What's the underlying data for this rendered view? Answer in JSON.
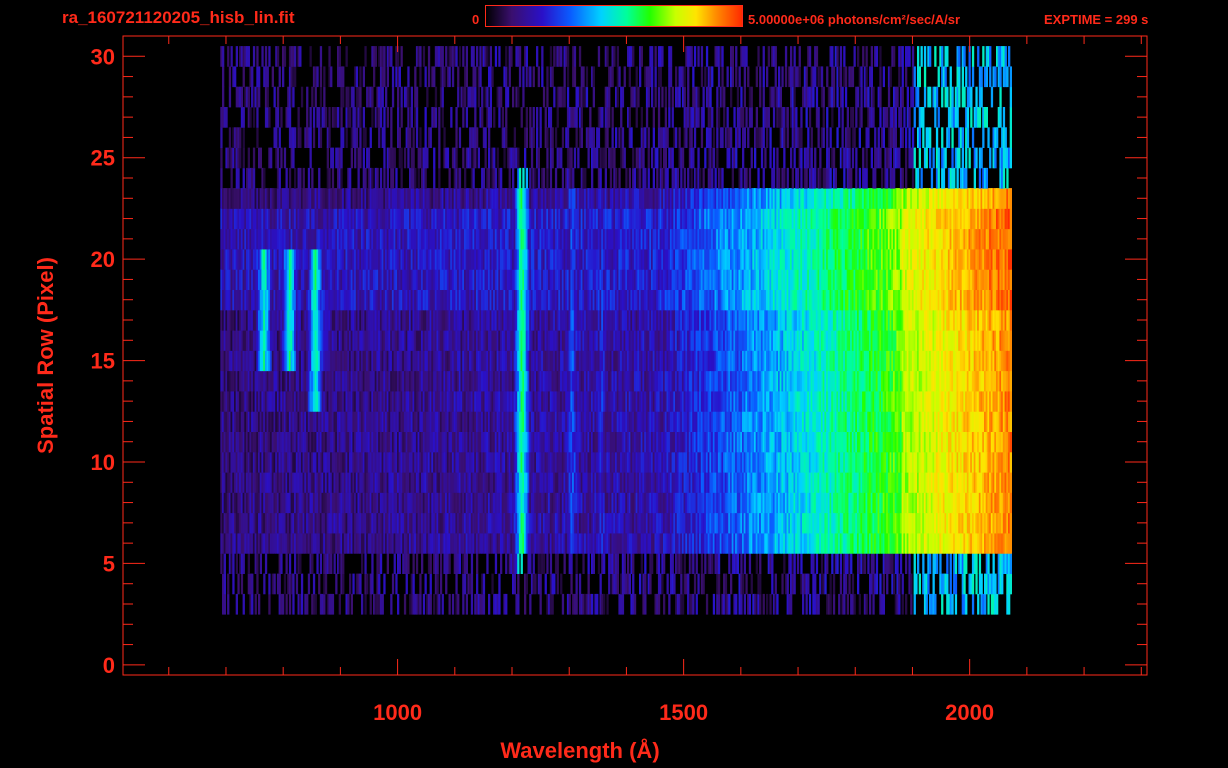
{
  "header": {
    "file_title": "ra_160721120205_hisb_lin.fit",
    "colorbar_min_label": "0",
    "colorbar_max_label": "5.00000e+06 photons/cm²/sec/A/sr",
    "exptime_label": "EXPTIME = 299 s"
  },
  "colors": {
    "axis": "#ff2a1a",
    "background": "#000000",
    "colormap": [
      "#000000",
      "#3a0f6e",
      "#2a10c8",
      "#0a5cff",
      "#00d2ff",
      "#00ff9a",
      "#22ff00",
      "#c8ff00",
      "#ffe400",
      "#ff8a00",
      "#ff2a00"
    ]
  },
  "chart_data": {
    "type": "heatmap",
    "title": "ra_160721120205_hisb_lin.fit",
    "xlabel": "Wavelength (Å)",
    "ylabel": "Spatial Row (Pixel)",
    "xlim": [
      520,
      2310
    ],
    "ylim": [
      -0.5,
      31
    ],
    "x_ticks": [
      1000,
      1500,
      2000
    ],
    "x_tick_labels": [
      "1000",
      "1500",
      "2000"
    ],
    "y_ticks": [
      0,
      5,
      10,
      15,
      20,
      25,
      30
    ],
    "y_tick_labels": [
      "0",
      "5",
      "10",
      "15",
      "20",
      "25",
      "30"
    ],
    "color_range": [
      0,
      5000000
    ],
    "color_unit": "photons/cm²/sec/A/sr",
    "data_x_range": [
      690,
      2070
    ],
    "slit_rows": [
      3,
      30
    ],
    "bright_rows": [
      6,
      23
    ],
    "features": [
      {
        "wavelength": 1216,
        "rows": [
          5,
          24
        ],
        "level": 0.55
      },
      {
        "wavelength": 1304,
        "rows": [
          6,
          23
        ],
        "level": 0.28
      },
      {
        "wavelength": 1356,
        "rows": [
          6,
          23
        ],
        "level": 0.22
      },
      {
        "wavelength": 765,
        "rows": [
          15,
          20
        ],
        "level": 0.5
      },
      {
        "wavelength": 810,
        "rows": [
          15,
          20
        ],
        "level": 0.5
      },
      {
        "wavelength": 855,
        "rows": [
          13,
          20
        ],
        "level": 0.5
      }
    ],
    "peak_level_near_2000": 0.9
  }
}
